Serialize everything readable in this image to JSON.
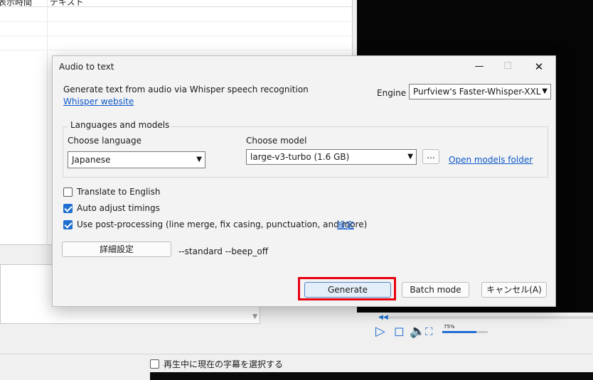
{
  "background": {
    "grid_headers": [
      "表示時間",
      "テキスト"
    ],
    "player": {
      "rewind_icon": "rewind-icon",
      "volume_label": "75%",
      "volume_fraction": 0.75
    },
    "play_selection_label": "再生中に現在の字幕を選択する"
  },
  "dialog": {
    "title": "Audio to text",
    "controls": {
      "minimize": "—",
      "maximize": "☐",
      "close": "✕"
    },
    "description": "Generate text from audio via Whisper speech recognition",
    "website_link": "Whisper website",
    "engine_label": "Engine",
    "engine_value": "Purfview's Faster-Whisper-XXL",
    "languages_group_title": "Languages and models",
    "language_label": "Choose language",
    "language_value": "Japanese",
    "model_label": "Choose model",
    "model_value": "large-v3-turbo (1.6 GB)",
    "browse_label": "...",
    "open_models_link": "Open models folder",
    "translate_label": "Translate to English",
    "translate_checked": false,
    "auto_adjust_label": "Auto adjust timings",
    "auto_adjust_checked": true,
    "post_processing_label": "Use post-processing (line merge, fix casing, punctuation, and more)",
    "post_processing_checked": true,
    "settings_link": "設定",
    "advanced_button": "詳細設定",
    "advanced_params": "--standard --beep_off",
    "generate_button": "Generate",
    "batch_button": "Batch mode",
    "cancel_button": "キャンセル(A)"
  },
  "colors": {
    "accent": "#1f6fd1",
    "highlight": "#e60012",
    "link": "#0b57c9"
  }
}
